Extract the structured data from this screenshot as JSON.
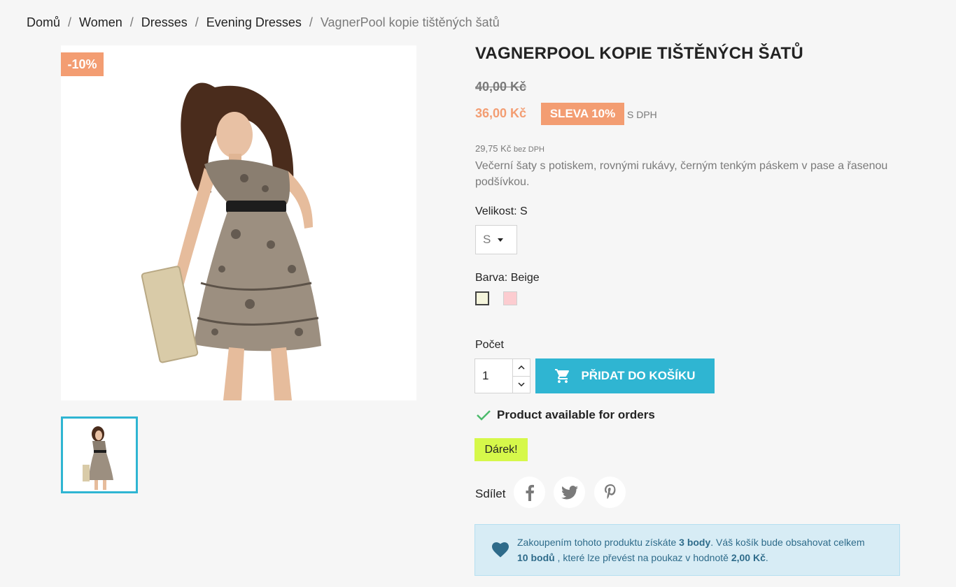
{
  "breadcrumb": {
    "items": [
      "Domů",
      "Women",
      "Dresses",
      "Evening Dresses"
    ],
    "current": "VagnerPool kopie tištěných šatů"
  },
  "product": {
    "flag": "-10%",
    "title": "VAGNERPOOL KOPIE TIŠTĚNÝCH ŠATŮ",
    "regular_price": "40,00 Kč",
    "price": "36,00 Kč",
    "discount_badge": "SLEVA 10%",
    "tax_label": "S DPH",
    "price_tax_excl": "29,75 Kč",
    "tax_excl_label": "bez DPH",
    "description": "Večerní šaty s potiskem, rovnými rukávy, černým tenkým páskem v pase a řasenou podšívkou."
  },
  "variants": {
    "size_label": "Velikost: S",
    "size_selected": "S",
    "color_label": "Barva: Beige",
    "colors": [
      "#f5f5dc",
      "#fcccd0"
    ]
  },
  "cart": {
    "quantity_label": "Počet",
    "quantity": "1",
    "add_label": "PŘIDAT DO KOŠÍKU"
  },
  "availability": "Product available for orders",
  "gift": "Dárek!",
  "share": {
    "label": "Sdílet",
    "networks": [
      "facebook",
      "twitter",
      "pinterest"
    ]
  },
  "loyalty": {
    "p1": "Zakoupením tohoto produktu získáte ",
    "points": "3 body",
    "p2": ". Váš košík bude obsahovat celkem ",
    "total_points": "10 bodů",
    "p3": " , které lze převést na poukaz v hodnotě ",
    "voucher": "2,00 Kč",
    "p4": "."
  },
  "colors": {
    "accent": "#2fb5d2",
    "discount": "#f39d72",
    "gift": "#d6f84a",
    "available": "#4cbb6c"
  }
}
